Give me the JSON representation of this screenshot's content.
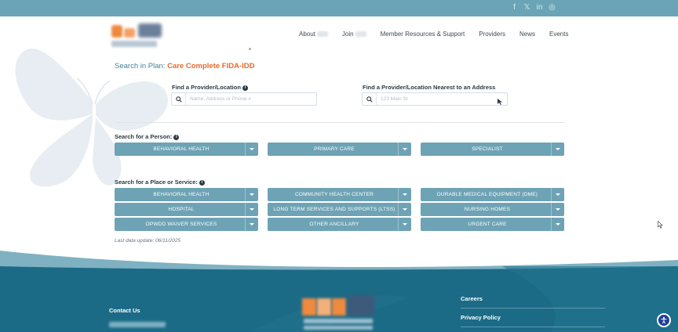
{
  "header": {
    "social": [
      {
        "name": "facebook-icon",
        "glyph": "f"
      },
      {
        "name": "x-icon",
        "glyph": "𝕏"
      },
      {
        "name": "linkedin-icon",
        "glyph": "in"
      },
      {
        "name": "instagram-icon",
        "glyph": "◎"
      }
    ],
    "nav": [
      {
        "label": "About"
      },
      {
        "label": "Join"
      },
      {
        "label": "Member Resources & Support"
      },
      {
        "label": "Providers"
      },
      {
        "label": "News"
      },
      {
        "label": "Events"
      }
    ]
  },
  "plan": {
    "prefix": "Search in Plan: ",
    "name": "Care Complete FIDA-IDD"
  },
  "find": {
    "provider_label": "Find a Provider/Location",
    "provider_placeholder": "Name, Address or Phone #",
    "nearest_label": "Find a Provider/Location Nearest to an Address",
    "nearest_placeholder": "123 Main St"
  },
  "person": {
    "label": "Search for a Person:",
    "options": [
      "BEHAVIORAL HEALTH",
      "PRIMARY CARE",
      "SPECIALIST"
    ]
  },
  "place": {
    "label": "Search for a Place or Service:",
    "options": [
      "BEHAVIORAL HEALTH",
      "COMMUNITY HEALTH CENTER",
      "DURABLE MEDICAL EQUIPMENT (DME)",
      "HOSPITAL",
      "LONG TERM SERVICES AND SUPPORTS (LTSS)",
      "NURSING HOMES",
      "OPWDD WAIVER SERVICES",
      "OTHER ANCILLARY",
      "URGENT CARE"
    ]
  },
  "last_update": "Last data update: 06/11/2025",
  "footer": {
    "contact": "Contact Us",
    "links": [
      "Careers",
      "Privacy Policy"
    ]
  },
  "colors": {
    "topbar": "#6aa4b6",
    "dropdown": "#6ea3b5",
    "accent": "#e56b2e",
    "footer": "#1c6b86"
  }
}
